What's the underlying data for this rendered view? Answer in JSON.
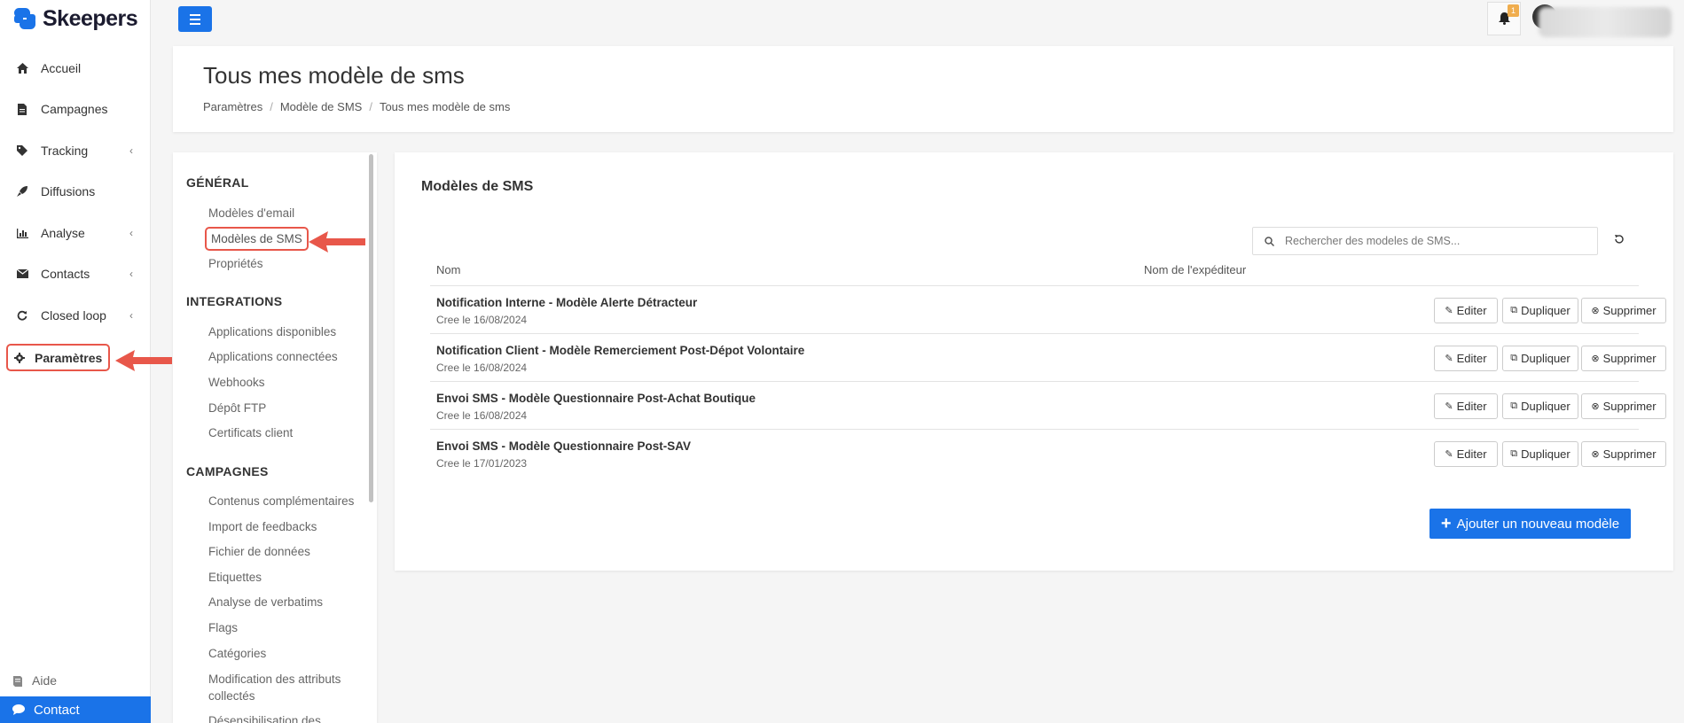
{
  "brand": {
    "name": "Skeepers",
    "color": "#1a73e8"
  },
  "sidebar": {
    "items": [
      {
        "label": "Accueil",
        "icon": "home-icon"
      },
      {
        "label": "Campagnes",
        "icon": "file-icon"
      },
      {
        "label": "Tracking",
        "icon": "tag-icon",
        "expandable": true
      },
      {
        "label": "Diffusions",
        "icon": "rocket-icon"
      },
      {
        "label": "Analyse",
        "icon": "bar-chart-icon",
        "expandable": true
      },
      {
        "label": "Contacts",
        "icon": "envelope-icon",
        "expandable": true
      },
      {
        "label": "Closed loop",
        "icon": "refresh-icon",
        "expandable": true
      },
      {
        "label": "Paramètres",
        "icon": "gear-icon",
        "active": true
      }
    ],
    "aide": "Aide",
    "contact": "Contact"
  },
  "topbar": {
    "notifications_count": "1"
  },
  "header": {
    "title": "Tous mes modèle de sms",
    "breadcrumb": [
      "Paramètres",
      "Modèle de SMS",
      "Tous mes modèle de sms"
    ]
  },
  "settings_menu": {
    "sections": [
      {
        "title": "GÉNÉRAL",
        "items": [
          "Modèles d'email",
          "Modèles de SMS",
          "Propriétés"
        ]
      },
      {
        "title": "INTEGRATIONS",
        "items": [
          "Applications disponibles",
          "Applications connectées",
          "Webhooks",
          "Dépôt FTP",
          "Certificats client"
        ]
      },
      {
        "title": "CAMPAGNES",
        "items": [
          "Contenus complémentaires",
          "Import de feedbacks",
          "Fichier de données",
          "Etiquettes",
          "Analyse de verbatims",
          "Flags",
          "Catégories",
          "Modification des attributs",
          "collectés",
          "Désensibilisation des"
        ]
      }
    ],
    "active_item": "Modèles de SMS"
  },
  "main": {
    "title": "Modèles de SMS",
    "search_placeholder": "Rechercher des modeles de SMS...",
    "columns": [
      "Nom",
      "Nom de l'expéditeur"
    ],
    "rows": [
      {
        "name": "Notification Interne - Modèle Alerte Détracteur",
        "date": "Cree le 16/08/2024"
      },
      {
        "name": "Notification Client - Modèle Remerciement Post-Dépot Volontaire",
        "date": "Cree le 16/08/2024"
      },
      {
        "name": "Envoi SMS - Modèle Questionnaire Post-Achat Boutique",
        "date": "Cree le 16/08/2024"
      },
      {
        "name": "Envoi SMS - Modèle Questionnaire Post-SAV",
        "date": "Cree le 17/01/2023"
      }
    ],
    "actions": {
      "edit": "Editer",
      "duplicate": "Dupliquer",
      "delete": "Supprimer"
    },
    "add_button": "Ajouter un nouveau modèle"
  },
  "colors": {
    "accent": "#1a73e8",
    "highlight": "#e8574a",
    "badge": "#f0ad4e"
  }
}
